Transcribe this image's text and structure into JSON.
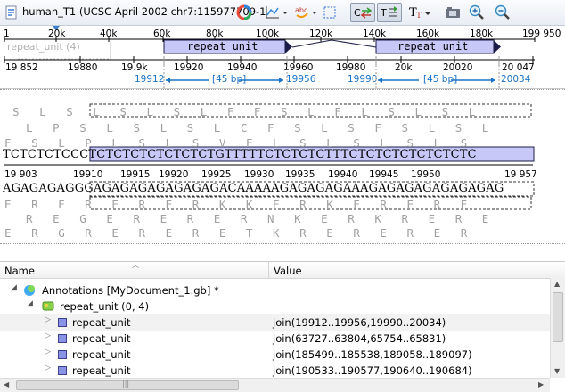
{
  "toolbar": {
    "title": "human_T1 (UCSC April 2002 chr7:115977709-1",
    "icons": [
      "sequence-doc-icon",
      "color-wheel-icon",
      "graph-icon",
      "abc-icon",
      "select-icon",
      "translation-toggle-icon",
      "show-complement-icon",
      "text-format-icon",
      "capture-icon",
      "zoom-in-icon",
      "zoom-out-icon"
    ]
  },
  "overview": {
    "ruler_labels": [
      "1",
      "20k",
      "40k",
      "60k",
      "80k",
      "100k",
      "120k",
      "140k",
      "160k",
      "180k",
      "199 950"
    ],
    "repeat_unit_label": "repeat_unit (4)",
    "feature_label": "repeat unit",
    "detail_labels": [
      "19 852",
      "19880",
      "19.9k",
      "19920",
      "19940",
      "19960",
      "19980",
      "20k",
      "20020",
      "20 047"
    ],
    "range1_start": "19912",
    "range1_len": "[45 bp]",
    "range1_end": "19956",
    "range2_start": "19990",
    "range2_len": "[45 bp]",
    "range2_end": "20034"
  },
  "sequence": {
    "aa_rows": [
      "S   L   S   L   S   L   S   L   F   F   S   L   F   L   S   L   S   L",
      "  L   P   S   L   S   L   S   L   C   F   S   L   S   F   S   L   S   L",
      "F   S   L   P   L   S   L   S   V   F   L   S   L   S   L   S   L   S",
      "E   R   E   R   E   R   E   R   K   K   E   R   K   E   R   E   R   E",
      "  R   E   G   E   R   E   R   E   R   N   K   E   R   K   R   E   R   E",
      "E   R   G   R   E   R   E   R   E   T   K   R   E   R   E   R   E   R"
    ],
    "top_strand": "TCTCTCTCCCTCTCTCTCTCTCTCTGTTTTTCTCTCTCTTTCTCTCTCTCTCTCTC",
    "bottom_strand": "AGAGAGAGGGAGAGAGAGAGAGAGACAAAAAGAGAGAGAAAGAGAGAGAGAGAGAG",
    "pos_labels": [
      "19 903",
      "19910",
      "19915",
      "19920",
      "19925",
      "19930",
      "19935",
      "19940",
      "19945",
      "19950",
      "19 957"
    ]
  },
  "tree": {
    "col_name": "Name",
    "col_value": "Value",
    "rows": [
      {
        "label": "Annotations [MyDocument_1.gb] *",
        "value": ""
      },
      {
        "label": "repeat_unit  (0, 4)",
        "value": ""
      },
      {
        "label": "repeat_unit",
        "value": "join(19912..19956,19990..20034)"
      },
      {
        "label": "repeat_unit",
        "value": "join(63727..63804,65754..65831)"
      },
      {
        "label": "repeat_unit",
        "value": "join(185499..185538,189058..189097)"
      },
      {
        "label": "repeat_unit",
        "value": "join(190533..190577,190640..190684)"
      }
    ]
  },
  "colors": {
    "feature_fill": "#c8c8f8",
    "feature_border": "#1c1c4a",
    "range_blue": "#1a73c8",
    "toolbar": "#e8edf4"
  }
}
